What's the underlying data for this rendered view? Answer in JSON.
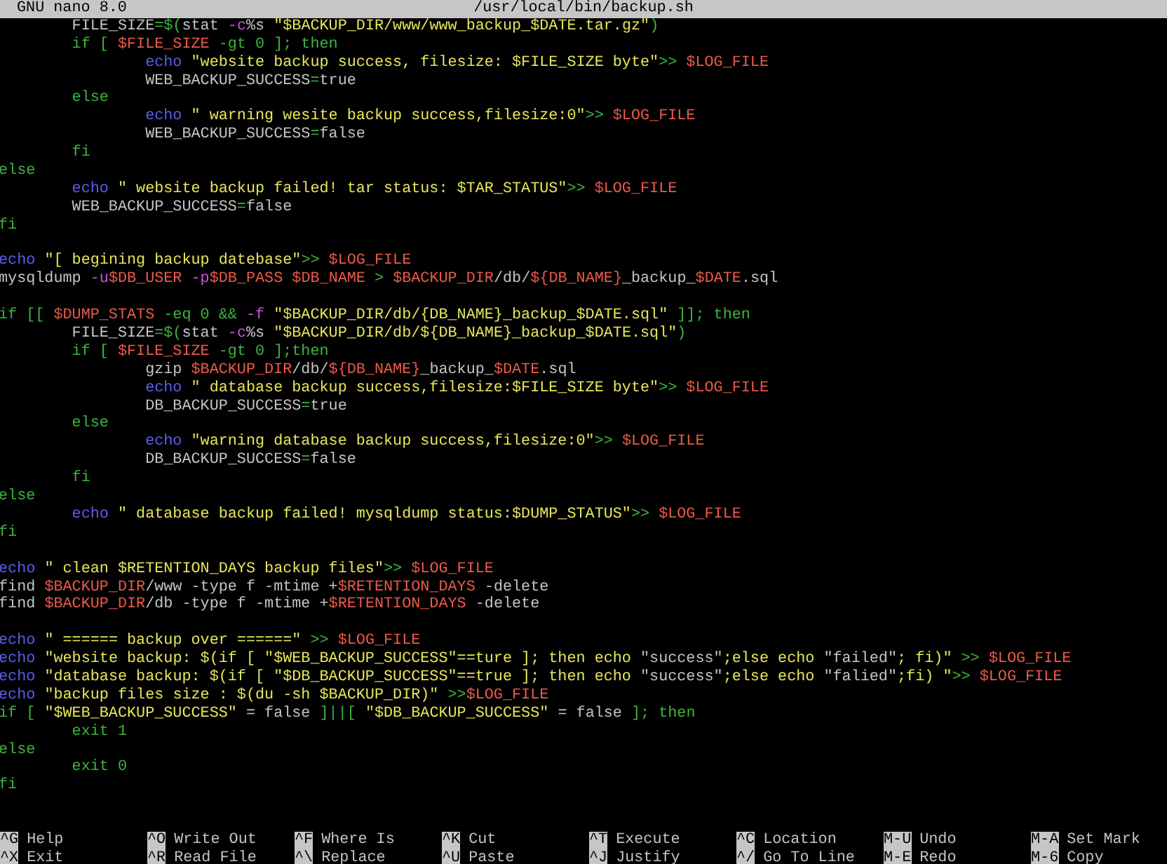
{
  "title_bar": {
    "app": "GNU nano 8.0",
    "file": "/usr/local/bin/backup.sh"
  },
  "lines": [
    {
      "kind": "code",
      "segments": [
        {
          "text": "        FILE_SIZE",
          "color": "#c4c4c4"
        },
        {
          "text": "=$(",
          "color": "#3cb43c"
        },
        {
          "text": "stat ",
          "color": "#c4c4c4"
        },
        {
          "text": "-c",
          "color": "#d050e0"
        },
        {
          "text": "%s ",
          "color": "#c4c4c4"
        },
        {
          "text": "\"$BACKUP_DIR/www/www_backup_$DATE.tar.gz\"",
          "color": "#e6e65a"
        },
        {
          "text": ")",
          "color": "#3cb43c"
        }
      ]
    },
    {
      "kind": "code",
      "segments": [
        {
          "text": "        if [ ",
          "color": "#3cb43c"
        },
        {
          "text": "$FILE_SIZE",
          "color": "#ec5a4a"
        },
        {
          "text": " -gt 0 ]; then",
          "color": "#3cb43c"
        }
      ]
    },
    {
      "kind": "code",
      "segments": [
        {
          "text": "                echo",
          "color": "#5c5cf0"
        },
        {
          "text": " \"website backup success, filesize: $FILE_SIZE byte\"",
          "color": "#e6e65a"
        },
        {
          "text": ">> ",
          "color": "#3cb43c"
        },
        {
          "text": "$LOG_FILE",
          "color": "#ec5a4a"
        }
      ]
    },
    {
      "kind": "code",
      "segments": [
        {
          "text": "                WEB_BACKUP_SUCCESS",
          "color": "#c4c4c4"
        },
        {
          "text": "=",
          "color": "#3cb43c"
        },
        {
          "text": "true",
          "color": "#c4c4c4"
        }
      ]
    },
    {
      "kind": "code",
      "segments": [
        {
          "text": "        else",
          "color": "#3cb43c"
        }
      ]
    },
    {
      "kind": "code",
      "segments": [
        {
          "text": "                echo",
          "color": "#5c5cf0"
        },
        {
          "text": " \" warning wesite backup success,filesize:0\"",
          "color": "#e6e65a"
        },
        {
          "text": ">> ",
          "color": "#3cb43c"
        },
        {
          "text": "$LOG_FILE",
          "color": "#ec5a4a"
        }
      ]
    },
    {
      "kind": "code",
      "segments": [
        {
          "text": "                WEB_BACKUP_SUCCESS",
          "color": "#c4c4c4"
        },
        {
          "text": "=",
          "color": "#3cb43c"
        },
        {
          "text": "false",
          "color": "#c4c4c4"
        }
      ]
    },
    {
      "kind": "code",
      "segments": [
        {
          "text": "        fi",
          "color": "#3cb43c"
        }
      ]
    },
    {
      "kind": "code",
      "segments": [
        {
          "text": "else",
          "color": "#3cb43c"
        }
      ]
    },
    {
      "kind": "code",
      "segments": [
        {
          "text": "        echo",
          "color": "#5c5cf0"
        },
        {
          "text": " \" website backup failed! tar status: $TAR_STATUS\"",
          "color": "#e6e65a"
        },
        {
          "text": ">> ",
          "color": "#3cb43c"
        },
        {
          "text": "$LOG_FILE",
          "color": "#ec5a4a"
        }
      ]
    },
    {
      "kind": "code",
      "segments": [
        {
          "text": "        WEB_BACKUP_SUCCESS",
          "color": "#c4c4c4"
        },
        {
          "text": "=",
          "color": "#3cb43c"
        },
        {
          "text": "false",
          "color": "#c4c4c4"
        }
      ]
    },
    {
      "kind": "code",
      "segments": [
        {
          "text": "fi",
          "color": "#3cb43c"
        }
      ]
    },
    {
      "kind": "blank"
    },
    {
      "kind": "code",
      "segments": [
        {
          "text": "echo",
          "color": "#5c5cf0"
        },
        {
          "text": " \"[ begining backup datebase\"",
          "color": "#e6e65a"
        },
        {
          "text": ">> ",
          "color": "#3cb43c"
        },
        {
          "text": "$LOG_FILE",
          "color": "#ec5a4a"
        }
      ]
    },
    {
      "kind": "code",
      "segments": [
        {
          "text": "mysqldump ",
          "color": "#c4c4c4"
        },
        {
          "text": "-u",
          "color": "#d050e0"
        },
        {
          "text": "$DB_USER",
          "color": "#ec5a4a"
        },
        {
          "text": " -p",
          "color": "#d050e0"
        },
        {
          "text": "$DB_PASS",
          "color": "#ec5a4a"
        },
        {
          "text": " $DB_NAME",
          "color": "#ec5a4a"
        },
        {
          "text": " > ",
          "color": "#3cb43c"
        },
        {
          "text": "$BACKUP_DIR",
          "color": "#ec5a4a"
        },
        {
          "text": "/db/",
          "color": "#c4c4c4"
        },
        {
          "text": "${DB_NAME}",
          "color": "#ec5a4a"
        },
        {
          "text": "_backup_",
          "color": "#c4c4c4"
        },
        {
          "text": "$DATE",
          "color": "#ec5a4a"
        },
        {
          "text": ".sql",
          "color": "#c4c4c4"
        }
      ]
    },
    {
      "kind": "blank"
    },
    {
      "kind": "code",
      "segments": [
        {
          "text": "if [[ ",
          "color": "#3cb43c"
        },
        {
          "text": "$DUMP_STATS",
          "color": "#ec5a4a"
        },
        {
          "text": " -eq 0 && ",
          "color": "#3cb43c"
        },
        {
          "text": "-f ",
          "color": "#d050e0"
        },
        {
          "text": "\"$BACKUP_DIR/db/{DB_NAME}_backup_$DATE.sql\"",
          "color": "#e6e65a"
        },
        {
          "text": " ]]; then",
          "color": "#3cb43c"
        }
      ]
    },
    {
      "kind": "code",
      "segments": [
        {
          "text": "        FILE_SIZE",
          "color": "#c4c4c4"
        },
        {
          "text": "=$(",
          "color": "#3cb43c"
        },
        {
          "text": "stat ",
          "color": "#c4c4c4"
        },
        {
          "text": "-c",
          "color": "#d050e0"
        },
        {
          "text": "%s ",
          "color": "#c4c4c4"
        },
        {
          "text": "\"$BACKUP_DIR/db/${DB_NAME}_backup_$DATE.sql\"",
          "color": "#e6e65a"
        },
        {
          "text": ")",
          "color": "#3cb43c"
        }
      ]
    },
    {
      "kind": "code",
      "segments": [
        {
          "text": "        if [ ",
          "color": "#3cb43c"
        },
        {
          "text": "$FILE_SIZE",
          "color": "#ec5a4a"
        },
        {
          "text": " -gt 0 ];then",
          "color": "#3cb43c"
        }
      ]
    },
    {
      "kind": "code",
      "segments": [
        {
          "text": "                gzip ",
          "color": "#c4c4c4"
        },
        {
          "text": "$BACKUP_DIR",
          "color": "#ec5a4a"
        },
        {
          "text": "/db/",
          "color": "#c4c4c4"
        },
        {
          "text": "${DB_NAME}",
          "color": "#ec5a4a"
        },
        {
          "text": "_backup_",
          "color": "#c4c4c4"
        },
        {
          "text": "$DATE",
          "color": "#ec5a4a"
        },
        {
          "text": ".sql",
          "color": "#c4c4c4"
        }
      ]
    },
    {
      "kind": "code",
      "segments": [
        {
          "text": "                echo",
          "color": "#5c5cf0"
        },
        {
          "text": " \" database backup success,filesize:$FILE_SIZE byte\"",
          "color": "#e6e65a"
        },
        {
          "text": ">> ",
          "color": "#3cb43c"
        },
        {
          "text": "$LOG_FILE",
          "color": "#ec5a4a"
        }
      ]
    },
    {
      "kind": "code",
      "segments": [
        {
          "text": "                DB_BACKUP_SUCCESS",
          "color": "#c4c4c4"
        },
        {
          "text": "=",
          "color": "#3cb43c"
        },
        {
          "text": "true",
          "color": "#c4c4c4"
        }
      ]
    },
    {
      "kind": "code",
      "segments": [
        {
          "text": "        else",
          "color": "#3cb43c"
        }
      ]
    },
    {
      "kind": "code",
      "segments": [
        {
          "text": "                echo",
          "color": "#5c5cf0"
        },
        {
          "text": " \"warning database backup success,filesize:0\"",
          "color": "#e6e65a"
        },
        {
          "text": ">> ",
          "color": "#3cb43c"
        },
        {
          "text": "$LOG_FILE",
          "color": "#ec5a4a"
        }
      ]
    },
    {
      "kind": "code",
      "segments": [
        {
          "text": "                DB_BACKUP_SUCCESS",
          "color": "#c4c4c4"
        },
        {
          "text": "=",
          "color": "#3cb43c"
        },
        {
          "text": "false",
          "color": "#c4c4c4"
        }
      ]
    },
    {
      "kind": "code",
      "segments": [
        {
          "text": "        fi",
          "color": "#3cb43c"
        }
      ]
    },
    {
      "kind": "code",
      "segments": [
        {
          "text": "else",
          "color": "#3cb43c"
        }
      ]
    },
    {
      "kind": "code",
      "segments": [
        {
          "text": "        echo",
          "color": "#5c5cf0"
        },
        {
          "text": " \" database backup failed! mysqldump status:$DUMP_STATUS\"",
          "color": "#e6e65a"
        },
        {
          "text": ">> ",
          "color": "#3cb43c"
        },
        {
          "text": "$LOG_FILE",
          "color": "#ec5a4a"
        }
      ]
    },
    {
      "kind": "code",
      "segments": [
        {
          "text": "fi",
          "color": "#3cb43c"
        }
      ]
    },
    {
      "kind": "blank"
    },
    {
      "kind": "code",
      "segments": [
        {
          "text": "echo",
          "color": "#5c5cf0"
        },
        {
          "text": " \" clean $RETENTION_DAYS backup files\"",
          "color": "#e6e65a"
        },
        {
          "text": ">> ",
          "color": "#3cb43c"
        },
        {
          "text": "$LOG_FILE",
          "color": "#ec5a4a"
        }
      ]
    },
    {
      "kind": "code",
      "segments": [
        {
          "text": "find ",
          "color": "#c4c4c4"
        },
        {
          "text": "$BACKUP_DIR",
          "color": "#ec5a4a"
        },
        {
          "text": "/www -type f -mtime +",
          "color": "#c4c4c4"
        },
        {
          "text": "$RETENTION_DAYS",
          "color": "#ec5a4a"
        },
        {
          "text": " -delete",
          "color": "#c4c4c4"
        }
      ]
    },
    {
      "kind": "code",
      "segments": [
        {
          "text": "find ",
          "color": "#c4c4c4"
        },
        {
          "text": "$BACKUP_DIR",
          "color": "#ec5a4a"
        },
        {
          "text": "/db -type f -mtime +",
          "color": "#c4c4c4"
        },
        {
          "text": "$RETENTION_DAYS",
          "color": "#ec5a4a"
        },
        {
          "text": " -delete",
          "color": "#c4c4c4"
        }
      ]
    },
    {
      "kind": "blank"
    },
    {
      "kind": "code",
      "segments": [
        {
          "text": "echo",
          "color": "#5c5cf0"
        },
        {
          "text": " \" ====== backup over ======\"",
          "color": "#e6e65a"
        },
        {
          "text": " >> ",
          "color": "#3cb43c"
        },
        {
          "text": "$LOG_FILE",
          "color": "#ec5a4a"
        }
      ]
    },
    {
      "kind": "code",
      "segments": [
        {
          "text": "echo",
          "color": "#5c5cf0"
        },
        {
          "text": " \"website backup: $(if [ \"$WEB_BACKUP_SUCCESS\"==ture ]; then echo ",
          "color": "#e6e65a"
        },
        {
          "text": "\"success\"",
          "color": "#c4c4c4"
        },
        {
          "text": ";else echo ",
          "color": "#e6e65a"
        },
        {
          "text": "\"failed\"",
          "color": "#c4c4c4"
        },
        {
          "text": "; fi)\"",
          "color": "#e6e65a"
        },
        {
          "text": " >> ",
          "color": "#3cb43c"
        },
        {
          "text": "$LOG_FILE",
          "color": "#ec5a4a"
        }
      ]
    },
    {
      "kind": "code",
      "segments": [
        {
          "text": "echo",
          "color": "#5c5cf0"
        },
        {
          "text": " \"database backup: $(if [ \"$DB_BACKUP_SUCCESS\"==true ]; then echo ",
          "color": "#e6e65a"
        },
        {
          "text": "\"success\"",
          "color": "#c4c4c4"
        },
        {
          "text": ";else echo ",
          "color": "#e6e65a"
        },
        {
          "text": "\"falied\"",
          "color": "#c4c4c4"
        },
        {
          "text": ";fi) \"",
          "color": "#e6e65a"
        },
        {
          "text": ">> ",
          "color": "#3cb43c"
        },
        {
          "text": "$LOG_FILE",
          "color": "#ec5a4a"
        }
      ]
    },
    {
      "kind": "code",
      "segments": [
        {
          "text": "echo",
          "color": "#5c5cf0"
        },
        {
          "text": " \"backup files size : $(du -sh $BACKUP_DIR)\"",
          "color": "#e6e65a"
        },
        {
          "text": " >>",
          "color": "#3cb43c"
        },
        {
          "text": "$LOG_FILE",
          "color": "#ec5a4a"
        }
      ]
    },
    {
      "kind": "code",
      "segments": [
        {
          "text": "if [ ",
          "color": "#3cb43c"
        },
        {
          "text": "\"$WEB_BACKUP_SUCCESS\"",
          "color": "#e6e65a"
        },
        {
          "text": " = false ",
          "color": "#c4c4c4"
        },
        {
          "text": "]||[ ",
          "color": "#3cb43c"
        },
        {
          "text": "\"$DB_BACKUP_SUCCESS\"",
          "color": "#e6e65a"
        },
        {
          "text": " = false ",
          "color": "#c4c4c4"
        },
        {
          "text": "]; then",
          "color": "#3cb43c"
        }
      ]
    },
    {
      "kind": "code",
      "segments": [
        {
          "text": "        exit 1",
          "color": "#3cb43c"
        }
      ]
    },
    {
      "kind": "code",
      "segments": [
        {
          "text": "else",
          "color": "#3cb43c"
        }
      ]
    },
    {
      "kind": "code",
      "segments": [
        {
          "text": "        exit 0",
          "color": "#3cb43c"
        }
      ]
    },
    {
      "kind": "code",
      "segments": [
        {
          "text": "fi",
          "color": "#3cb43c"
        }
      ]
    }
  ],
  "shortcut_rows": [
    {
      "items": [
        {
          "key": "^G",
          "label": "Help"
        },
        {
          "key": "^O",
          "label": "Write Out"
        },
        {
          "key": "^F",
          "label": "Where Is"
        },
        {
          "key": "^K",
          "label": "Cut"
        },
        {
          "key": "^T",
          "label": "Execute"
        },
        {
          "key": "^C",
          "label": "Location"
        },
        {
          "key": "M-U",
          "label": "Undo"
        },
        {
          "key": "M-A",
          "label": "Set Mark"
        }
      ]
    },
    {
      "items": [
        {
          "key": "^X",
          "label": "Exit"
        },
        {
          "key": "^R",
          "label": "Read File"
        },
        {
          "key": "^\\",
          "label": "Replace"
        },
        {
          "key": "^U",
          "label": "Paste"
        },
        {
          "key": "^J",
          "label": "Justify"
        },
        {
          "key": "^/",
          "label": "Go To Line"
        },
        {
          "key": "M-E",
          "label": "Redo"
        },
        {
          "key": "M-6",
          "label": "Copy"
        }
      ]
    }
  ]
}
